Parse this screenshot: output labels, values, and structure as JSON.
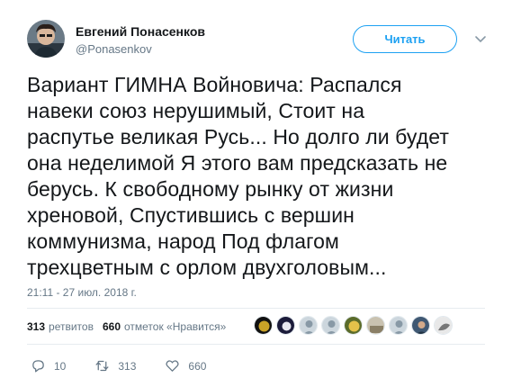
{
  "author": {
    "name": "Евгений Понасенков",
    "handle": "@Ponasenkov"
  },
  "follow_label": "Читать",
  "tweet_lines": [
    "Вариант ГИМНА Войновича: Распался",
    "навеки союз нерушимый, Стоит на",
    "распутье великая Русь... Но долго ли будет",
    "она неделимой Я этого вам предсказать не",
    "берусь. К свободному рынку от жизни",
    "хреновой, Спустившись с вершин",
    "коммунизма, народ Под флагом",
    "трехцветным с орлом двухголовым..."
  ],
  "timestamp": "21:11 - 27 июл. 2018 г.",
  "stats": {
    "retweets_count": "313",
    "retweets_label": "ретвитов",
    "likes_count": "660",
    "likes_label": "отметок «Нравится»"
  },
  "actions": {
    "replies": "10",
    "retweets": "313",
    "likes": "660"
  },
  "colors": {
    "accent": "#1da1f2",
    "text": "#14171a",
    "muted": "#657786",
    "divider": "#e6ecf0"
  }
}
